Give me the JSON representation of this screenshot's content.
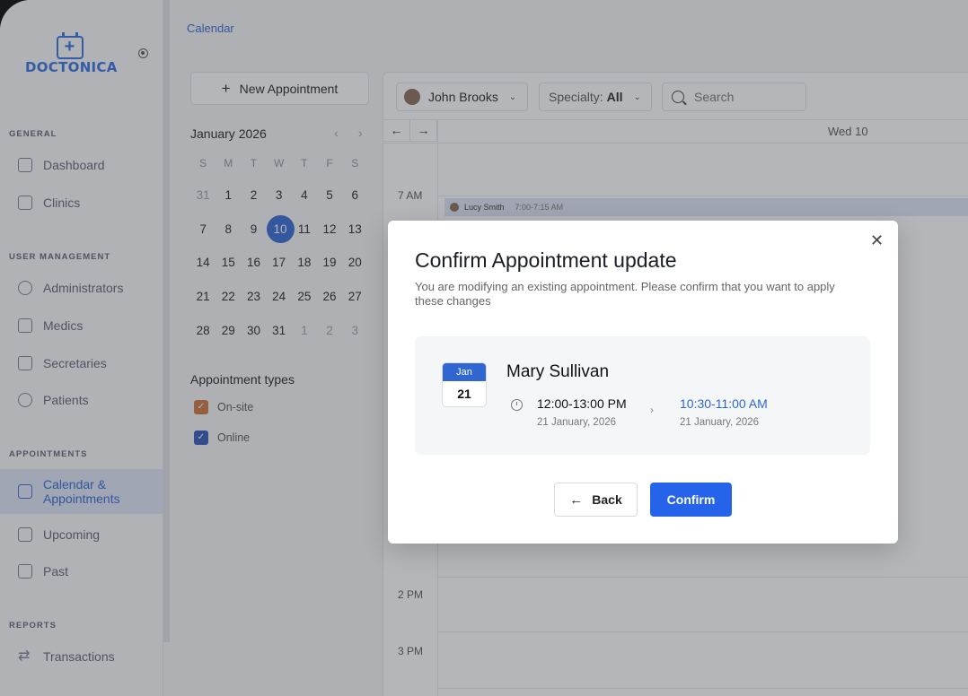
{
  "brand": {
    "name": "DOCTONICA"
  },
  "breadcrumb": "Calendar",
  "sidebar": {
    "sections": [
      {
        "title": "GENERAL",
        "items": [
          {
            "label": "Dashboard",
            "icon": "grid-icon"
          },
          {
            "label": "Clinics",
            "icon": "home-icon"
          }
        ]
      },
      {
        "title": "USER MANAGEMENT",
        "items": [
          {
            "label": "Administrators",
            "icon": "user-circle-icon"
          },
          {
            "label": "Medics",
            "icon": "id-card-icon"
          },
          {
            "label": "Secretaries",
            "icon": "id-badge-icon"
          },
          {
            "label": "Patients",
            "icon": "person-icon"
          }
        ]
      },
      {
        "title": "APPOINTMENTS",
        "items": [
          {
            "label": "Calendar & Appointments",
            "label_line1": "Calendar &",
            "label_line2": "Appointments",
            "icon": "calendar-icon",
            "active": true
          },
          {
            "label": "Upcoming",
            "icon": "calendar-upcoming-icon"
          },
          {
            "label": "Past",
            "icon": "calendar-check-icon"
          }
        ]
      },
      {
        "title": "REPORTS",
        "items": [
          {
            "label": "Transactions",
            "icon": "swap-icon"
          }
        ]
      }
    ]
  },
  "new_appointment": "New Appointment",
  "mini_calendar": {
    "title": "January 2026",
    "weekdays": [
      "S",
      "M",
      "T",
      "W",
      "T",
      "F",
      "S"
    ],
    "weeks": [
      [
        "31",
        "1",
        "2",
        "3",
        "4",
        "5",
        "6"
      ],
      [
        "7",
        "8",
        "9",
        "10",
        "11",
        "12",
        "13"
      ],
      [
        "14",
        "15",
        "16",
        "17",
        "18",
        "19",
        "20"
      ],
      [
        "21",
        "22",
        "23",
        "24",
        "25",
        "26",
        "27"
      ],
      [
        "28",
        "29",
        "30",
        "31",
        "1",
        "2",
        "3"
      ]
    ],
    "selected": "10"
  },
  "appointment_types": {
    "title": "Appointment types",
    "items": [
      {
        "label": "On-site",
        "color": "#c8773a"
      },
      {
        "label": "Online",
        "color": "#2f55b8"
      }
    ]
  },
  "toolbar": {
    "doctor": "John Brooks",
    "specialty_label": "Specialty:",
    "specialty_value": "All",
    "search_placeholder": "Search"
  },
  "calendar": {
    "day_header": "Wed  10",
    "hours": [
      "7 AM",
      "2 PM",
      "3 PM"
    ],
    "event": {
      "patient": "Lucy Smith",
      "time": "7:00-7:15 AM"
    }
  },
  "modal": {
    "title": "Confirm Appointment update",
    "description": "You are modifying an existing appointment. Please confirm that you want to apply these changes",
    "date_month": "Jan",
    "date_day": "21",
    "patient": "Mary Sullivan",
    "old_time": "12:00-13:00 PM",
    "old_date": "21 January, 2026",
    "new_time": "10:30-11:00 AM",
    "new_date": "21 January, 2026",
    "back": "Back",
    "confirm": "Confirm"
  },
  "colors": {
    "accent": "#2f66d2",
    "confirm": "#2563eb"
  }
}
